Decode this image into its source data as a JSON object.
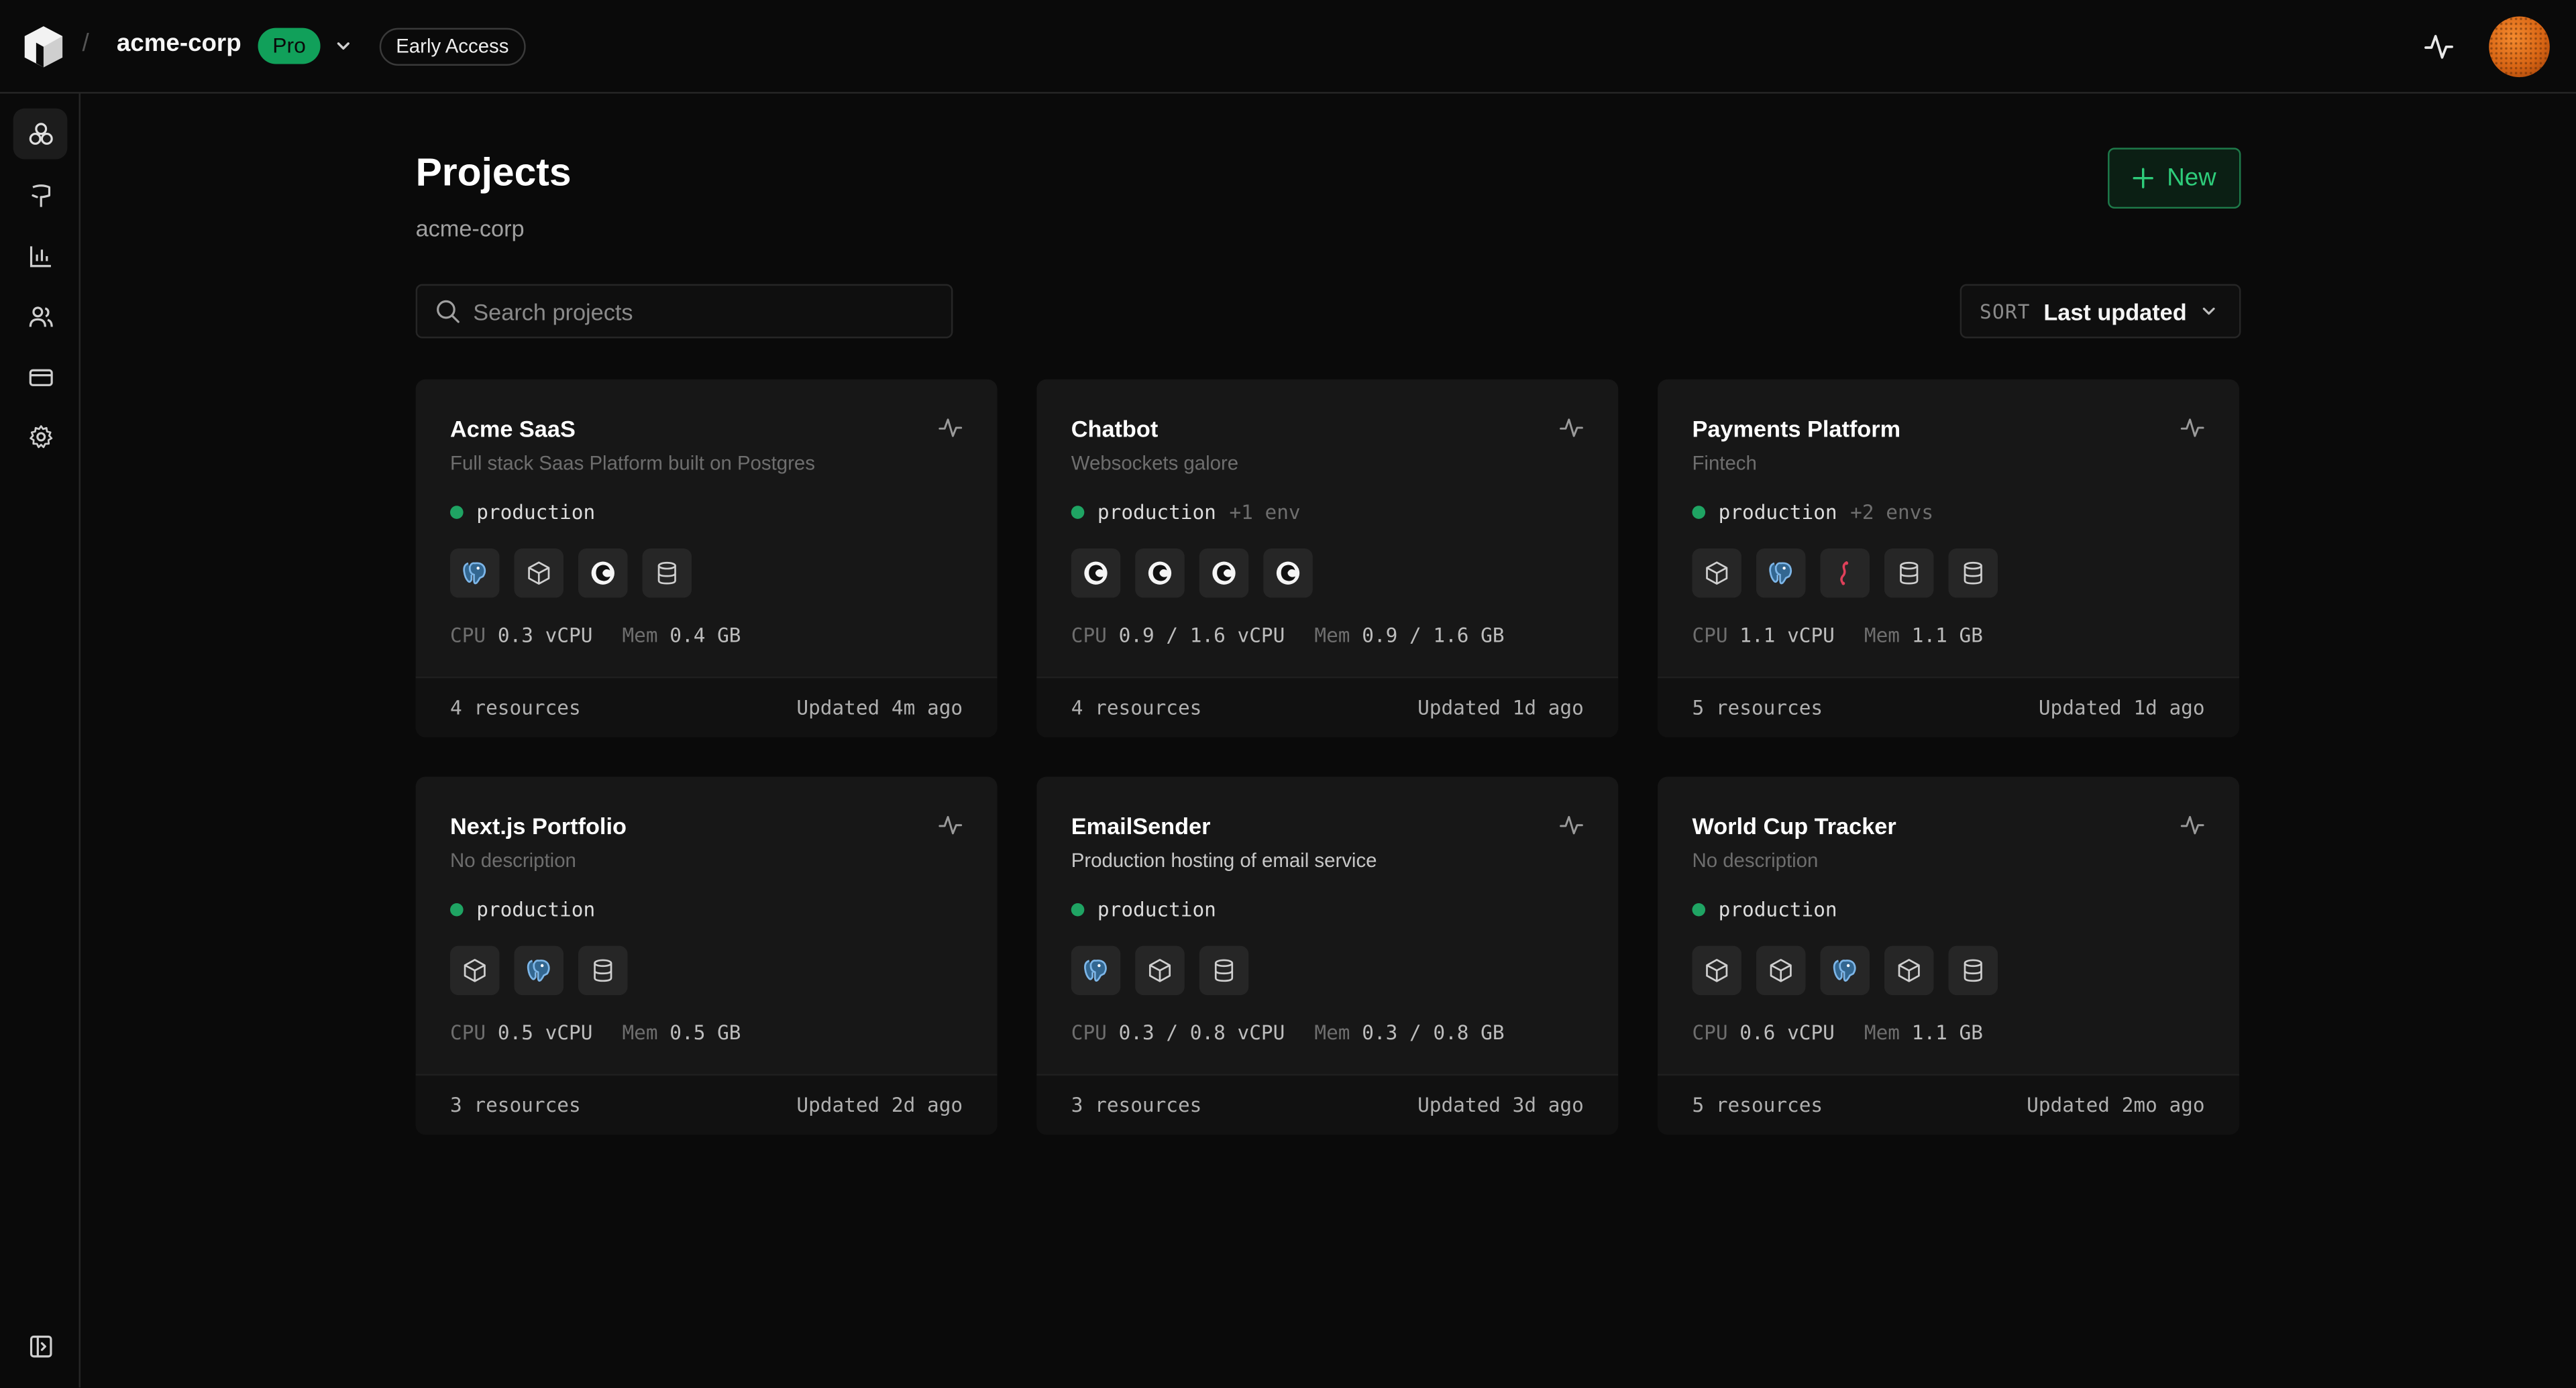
{
  "header": {
    "org_name": "acme-corp",
    "plan_badge": "Pro",
    "early_access": "Early Access"
  },
  "page": {
    "title": "Projects",
    "subtitle": "acme-corp",
    "new_button": "New",
    "search_placeholder": "Search projects",
    "sort_label": "SORT",
    "sort_value": "Last updated"
  },
  "colors": {
    "accent": "#11a05a",
    "background": "#0a0a0a",
    "card": "#171717"
  },
  "sidebar": {
    "items": [
      {
        "icon": "projects-icon",
        "active": true
      },
      {
        "icon": "git-icon",
        "active": false
      },
      {
        "icon": "usage-chart-icon",
        "active": false
      },
      {
        "icon": "team-icon",
        "active": false
      },
      {
        "icon": "billing-card-icon",
        "active": false
      },
      {
        "icon": "settings-gear-icon",
        "active": false
      }
    ],
    "collapse_icon": "sidebar-collapse-icon"
  },
  "projects": [
    {
      "name": "Acme SaaS",
      "description": "Full stack Saas Platform built on Postgres",
      "env": "production",
      "env_extra": "",
      "resources": [
        "postgres",
        "service",
        "app",
        "database"
      ],
      "cpu_label": "CPU",
      "cpu": "0.3 vCPU",
      "mem_label": "Mem",
      "mem": "0.4 GB",
      "resource_count": "4 resources",
      "updated": "Updated 4m ago"
    },
    {
      "name": "Chatbot",
      "description": "Websockets galore",
      "env": "production",
      "env_extra": "+1 env",
      "resources": [
        "app",
        "app",
        "app",
        "app"
      ],
      "cpu_label": "CPU",
      "cpu": "0.9 / 1.6 vCPU",
      "mem_label": "Mem",
      "mem": "0.9 / 1.6 GB",
      "resource_count": "4 resources",
      "updated": "Updated 1d ago"
    },
    {
      "name": "Payments Platform",
      "description": "Fintech",
      "env": "production",
      "env_extra": "+2 envs",
      "resources": [
        "service",
        "postgres",
        "queue",
        "database",
        "database"
      ],
      "cpu_label": "CPU",
      "cpu": "1.1 vCPU",
      "mem_label": "Mem",
      "mem": "1.1 GB",
      "resource_count": "5 resources",
      "updated": "Updated 1d ago"
    },
    {
      "name": "Next.js Portfolio",
      "description": "No description",
      "env": "production",
      "env_extra": "",
      "resources": [
        "service",
        "postgres",
        "database"
      ],
      "cpu_label": "CPU",
      "cpu": "0.5 vCPU",
      "mem_label": "Mem",
      "mem": "0.5 GB",
      "resource_count": "3 resources",
      "updated": "Updated 2d ago"
    },
    {
      "name": "EmailSender",
      "description": "Production hosting of email service",
      "env": "production",
      "env_extra": "",
      "resources": [
        "postgres",
        "service",
        "database"
      ],
      "cpu_label": "CPU",
      "cpu": "0.3 / 0.8 vCPU",
      "mem_label": "Mem",
      "mem": "0.3 / 0.8 GB",
      "resource_count": "3 resources",
      "updated": "Updated 3d ago"
    },
    {
      "name": "World Cup Tracker",
      "description": "No description",
      "env": "production",
      "env_extra": "",
      "resources": [
        "service",
        "service",
        "postgres",
        "service",
        "database"
      ],
      "cpu_label": "CPU",
      "cpu": "0.6 vCPU",
      "mem_label": "Mem",
      "mem": "1.1 GB",
      "resource_count": "5 resources",
      "updated": "Updated 2mo ago"
    }
  ]
}
